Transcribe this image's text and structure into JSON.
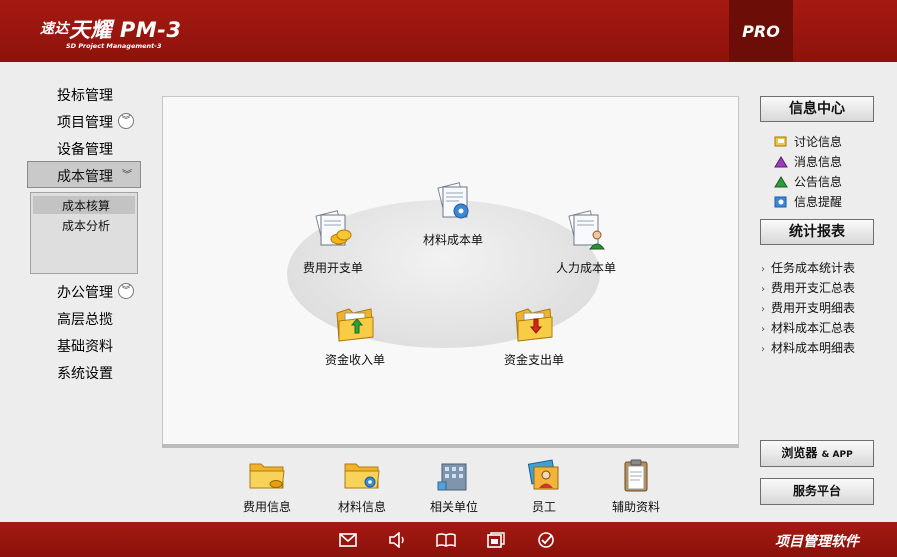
{
  "header": {
    "logo_prefix": "速达",
    "logo_name": "天耀",
    "logo_model": "PM-3",
    "logo_subtitle": "SD Project Management-3",
    "edition": "PRO"
  },
  "sidebar": {
    "items": [
      {
        "label": "投标管理"
      },
      {
        "label": "项目管理",
        "expand": "chevron-down-icon"
      },
      {
        "label": "设备管理"
      },
      {
        "label": "成本管理",
        "expanded": true
      },
      {
        "label": "办公管理",
        "expand": "chevron-down-icon"
      },
      {
        "label": "高层总揽"
      },
      {
        "label": "基础资料"
      },
      {
        "label": "系统设置"
      }
    ],
    "subitems": [
      {
        "label": "成本核算",
        "selected": true
      },
      {
        "label": "成本分析"
      }
    ]
  },
  "workflow": {
    "nodes": [
      {
        "label": "材料成本单",
        "icon": "document-gear-icon"
      },
      {
        "label": "费用开支单",
        "icon": "document-coins-icon"
      },
      {
        "label": "人力成本单",
        "icon": "document-person-icon"
      },
      {
        "label": "资金收入单",
        "icon": "folder-arrow-up-icon"
      },
      {
        "label": "资金支出单",
        "icon": "folder-arrow-down-icon"
      }
    ]
  },
  "dock": {
    "items": [
      {
        "label": "费用信息",
        "icon": "folder-coins-icon"
      },
      {
        "label": "材料信息",
        "icon": "folder-gear-icon"
      },
      {
        "label": "相关单位",
        "icon": "building-icon"
      },
      {
        "label": "员工",
        "icon": "employee-photos-icon"
      },
      {
        "label": "辅助资料",
        "icon": "clipboard-icon"
      }
    ]
  },
  "right": {
    "info_title": "信息中心",
    "info_items": [
      {
        "label": "讨论信息",
        "icon": "discussion-icon"
      },
      {
        "label": "消息信息",
        "icon": "message-icon"
      },
      {
        "label": "公告信息",
        "icon": "notice-icon"
      },
      {
        "label": "信息提醒",
        "icon": "reminder-icon"
      }
    ],
    "stats_title": "统计报表",
    "stats_items": [
      {
        "label": "任务成本统计表"
      },
      {
        "label": "费用开支汇总表"
      },
      {
        "label": "费用开支明细表"
      },
      {
        "label": "材料成本汇总表"
      },
      {
        "label": "材料成本明细表"
      }
    ],
    "browser_btn": {
      "main": "浏览器",
      "suffix": "& APP"
    },
    "service_btn": "服务平台"
  },
  "footer": {
    "title": "项目管理软件",
    "icons": [
      "mail-icon",
      "speaker-icon",
      "book-icon",
      "window-icon",
      "check-icon"
    ]
  },
  "colors": {
    "brand_red": "#9e1810",
    "dark_red": "#6d0d08"
  }
}
